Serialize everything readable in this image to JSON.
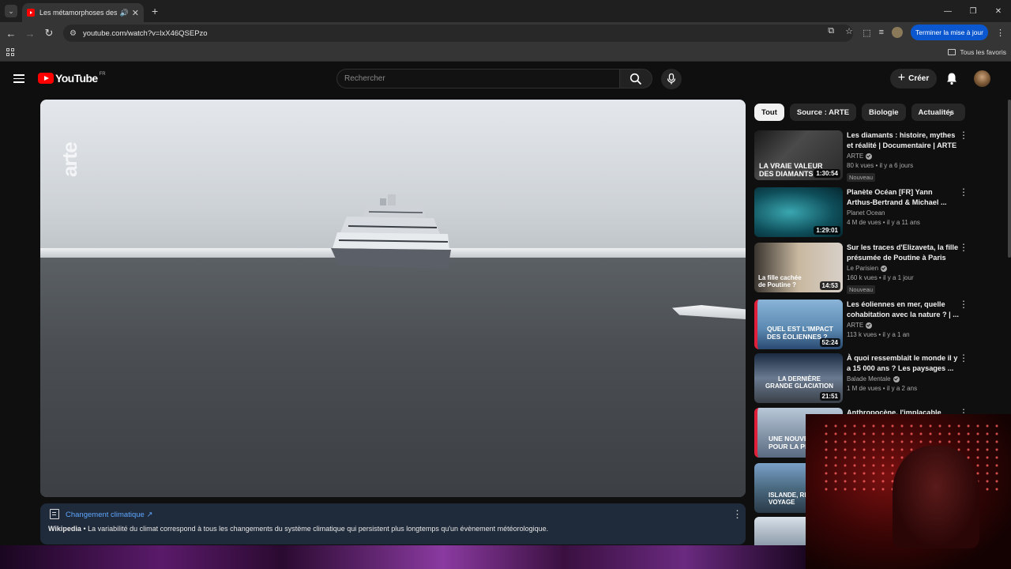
{
  "browser": {
    "tab_title": "Les métamorphoses des glac",
    "url": "youtube.com/watch?v=lxX46QSEPzo",
    "update_button": "Terminer la mise à jour",
    "all_bookmarks": "Tous les favoris"
  },
  "header": {
    "logo": "YouTube",
    "country": "FR",
    "search_placeholder": "Rechercher",
    "create_label": "Créer"
  },
  "player": {
    "watermark": "arte"
  },
  "info_card": {
    "link": "Changement climatique ↗",
    "source": "Wikipedia",
    "text": " • La variabilité du climat correspond à tous les changements du système climatique qui persistent plus longtemps qu'un évènement météorologique."
  },
  "chips": [
    "Tout",
    "Source : ARTE",
    "Biologie",
    "Actualités"
  ],
  "related": [
    {
      "title": "Les diamants : histoire, mythes et réalité | Documentaire | ARTE",
      "channel": "ARTE",
      "verified": true,
      "stats": "80 k vues • il y a 6 jours",
      "badge": "Nouveau",
      "duration": "1:30:54",
      "thumb_text": "LA VRAIE VALEUR DES DIAMANTS"
    },
    {
      "title": "Planète Océan [FR] Yann Arthus-Bertrand & Michael ...",
      "channel": "Planet Ocean",
      "verified": false,
      "stats": "4 M de vues • il y a 11 ans",
      "badge": "",
      "duration": "1:29:01",
      "thumb_text": ""
    },
    {
      "title": "Sur les traces d'Elizaveta, la fille présumée de Poutine à Paris",
      "channel": "Le Parisien",
      "verified": true,
      "stats": "160 k vues • il y a 1 jour",
      "badge": "Nouveau",
      "duration": "14:53",
      "thumb_text": "La fille cachée de Poutine ?"
    },
    {
      "title": "Les éoliennes en mer, quelle cohabitation avec la nature ? | ...",
      "channel": "ARTE",
      "verified": true,
      "stats": "113 k vues • il y a 1 an",
      "badge": "",
      "duration": "52:24",
      "thumb_text": "QUEL EST L'IMPACT DES ÉOLIENNES ?"
    },
    {
      "title": "À quoi ressemblait le monde il y a 15 000 ans ? Les paysages ...",
      "channel": "Balade Mentale",
      "verified": true,
      "stats": "1 M de vues • il y a 2 ans",
      "badge": "",
      "duration": "21:51",
      "thumb_text": "LA DERNIÈRE GRANDE GLACIATION"
    },
    {
      "title": "Anthropocène, l'implacable",
      "channel": "",
      "verified": false,
      "stats": "",
      "badge": "",
      "duration": "",
      "thumb_text": "UNE NOUVELLE ÈRE POUR LA PLANÈTE"
    },
    {
      "title": "",
      "channel": "",
      "verified": false,
      "stats": "",
      "badge": "",
      "duration": "",
      "thumb_text": "ISLANDE, RÉCIT DE VOYAGE"
    },
    {
      "title": "",
      "channel": "",
      "verified": false,
      "stats": "",
      "badge": "",
      "duration": "",
      "thumb_text": ""
    }
  ],
  "colors": {
    "brand": "#ff0000",
    "link": "#5fa8ff",
    "update": "#0b57d0"
  }
}
